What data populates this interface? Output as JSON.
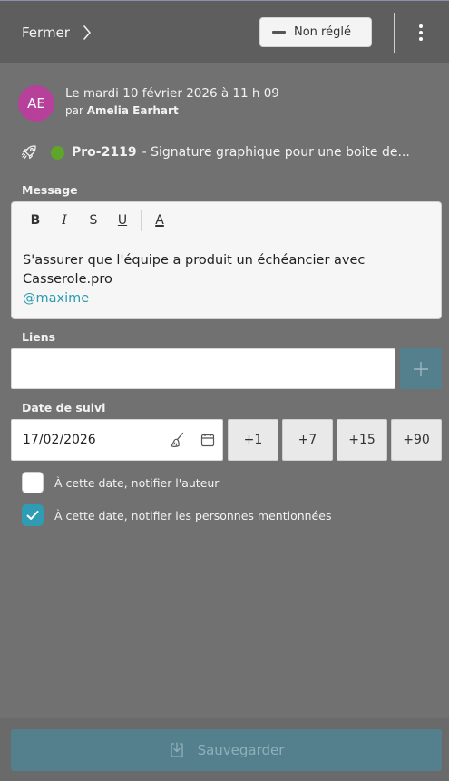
{
  "header": {
    "close_label": "Fermer",
    "status_label": "Non réglé"
  },
  "note": {
    "avatar_initials": "AE",
    "date_line": "Le mardi 10 février 2026 à 11 h 09",
    "author_prefix": "par",
    "author_name": "Amelia Earhart"
  },
  "task": {
    "status_color": "#5ea62a",
    "id": "Pro-2119",
    "title": "- Signature graphique pour une boite de..."
  },
  "message": {
    "label": "Message",
    "toolbar": [
      "B",
      "I",
      "S",
      "U",
      "A"
    ],
    "text_line1": "S'assurer que l'équipe a produit un échéancier avec",
    "text_line2": "Casserole.pro",
    "mention": "@maxime"
  },
  "links": {
    "label": "Liens",
    "value": ""
  },
  "followup": {
    "label": "Date de suivi",
    "date_value": "17/02/2026",
    "quick_buttons": [
      "+1",
      "+7",
      "+15",
      "+90"
    ]
  },
  "options": {
    "notify_author_label": "À cette date, notifier l'auteur",
    "notify_author_checked": false,
    "notify_mentioned_label": "À cette date, notifier les personnes mentionnées",
    "notify_mentioned_checked": true
  },
  "footer": {
    "save_label": "Sauvegarder"
  },
  "colors": {
    "accent": "#2f9cb4",
    "save_button": "#547f8c",
    "avatar": "#b6409a"
  }
}
